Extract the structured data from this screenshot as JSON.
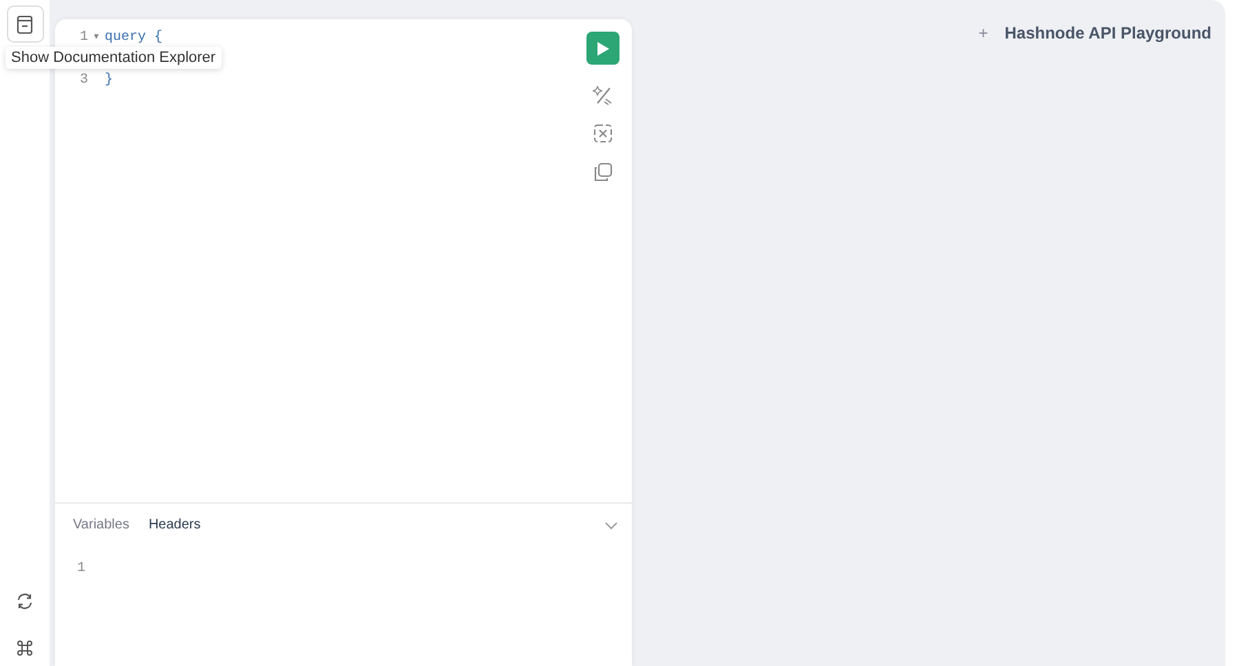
{
  "tooltip": "Show Documentation Explorer",
  "editor": {
    "lines": [
      {
        "number": "1",
        "fold": "▾",
        "code": "query {"
      },
      {
        "number": "3",
        "code": "}"
      }
    ]
  },
  "bottom_tabs": [
    {
      "label": "Variables",
      "selected": false
    },
    {
      "label": "Headers",
      "selected": true
    }
  ],
  "bottom_editor": {
    "lines": [
      {
        "number": "1"
      }
    ]
  },
  "tab_bar": {
    "add": "+",
    "tabs": [
      {
        "label": "Hashnode API Playground"
      }
    ]
  }
}
